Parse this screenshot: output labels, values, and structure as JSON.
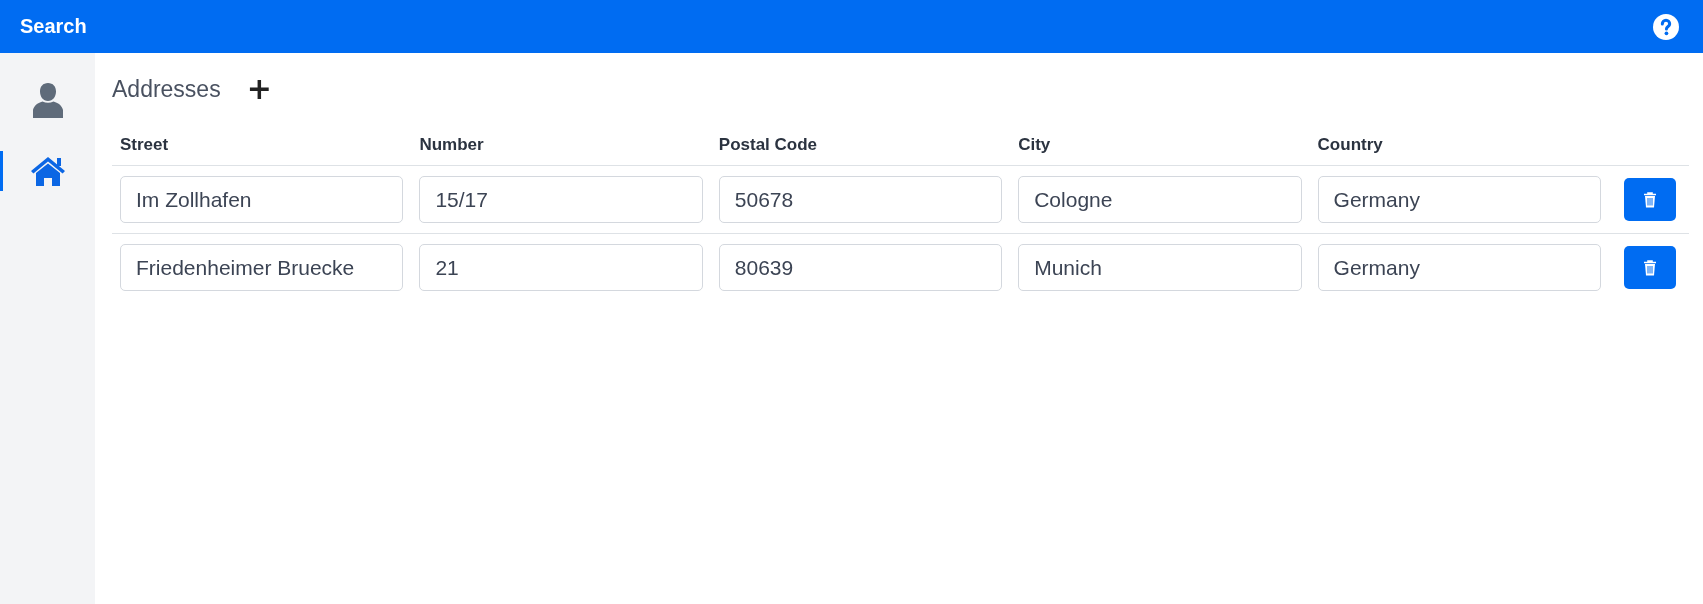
{
  "header": {
    "title": "Search"
  },
  "sidebar": {
    "items": [
      {
        "kind": "person",
        "selected": false
      },
      {
        "kind": "home",
        "selected": true
      }
    ]
  },
  "section": {
    "title": "Addresses",
    "add_label": "+"
  },
  "table": {
    "columns": [
      "Street",
      "Number",
      "Postal Code",
      "City",
      "Country"
    ],
    "rows": [
      {
        "cells": [
          "Im Zollhafen",
          "15/17",
          "50678",
          "Cologne",
          "Germany"
        ]
      },
      {
        "cells": [
          "Friedenheimer Bruecke",
          "21",
          "80639",
          "Munich",
          "Germany"
        ]
      }
    ]
  }
}
